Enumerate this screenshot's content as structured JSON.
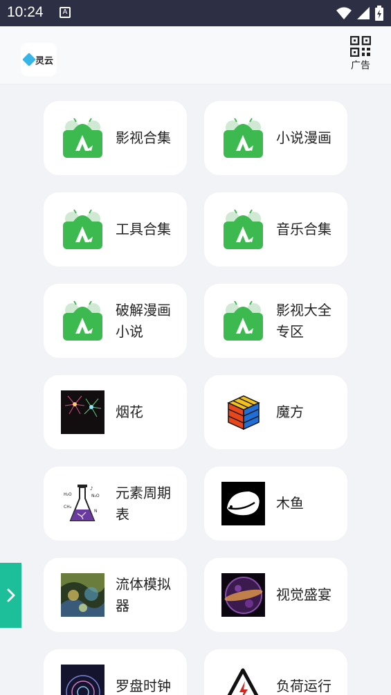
{
  "status_bar": {
    "time": "10:24",
    "app_icon_letter": "A",
    "icons": [
      "wifi-icon",
      "signal-icon",
      "battery-icon"
    ]
  },
  "header": {
    "logo_text": "灵云",
    "qr_label": "广告"
  },
  "cards": [
    {
      "label": "影视合集",
      "icon": "android-app-icon"
    },
    {
      "label": "小说漫画",
      "icon": "android-app-icon"
    },
    {
      "label": "工具合集",
      "icon": "android-app-icon"
    },
    {
      "label": "音乐合集",
      "icon": "android-app-icon"
    },
    {
      "label": "破解漫画小说",
      "icon": "android-app-icon"
    },
    {
      "label": "影视大全专区",
      "icon": "android-app-icon"
    },
    {
      "label": "烟花",
      "icon": "fireworks-icon"
    },
    {
      "label": "魔方",
      "icon": "rubiks-cube-icon"
    },
    {
      "label": "元素周期表",
      "icon": "chemistry-flask-icon"
    },
    {
      "label": "木鱼",
      "icon": "wooden-fish-icon"
    },
    {
      "label": "流体模拟器",
      "icon": "fluid-simulation-icon"
    },
    {
      "label": "视觉盛宴",
      "icon": "particle-sphere-icon"
    },
    {
      "label": "罗盘时钟",
      "icon": "compass-clock-icon"
    },
    {
      "label": "负荷运行",
      "icon": "high-voltage-warning-icon"
    }
  ],
  "colors": {
    "status_bar": "#2d2f45",
    "android_green": "#3dba4f",
    "side_tab": "#1dbf9a"
  }
}
